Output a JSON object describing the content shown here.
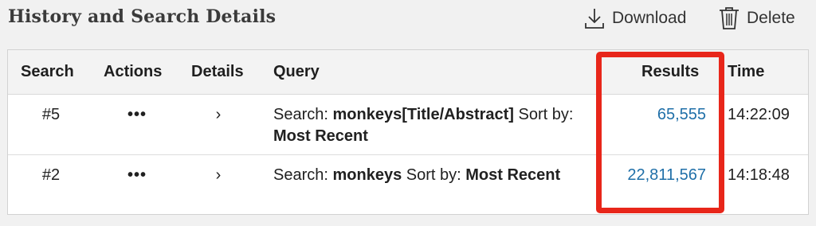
{
  "header": {
    "title": "History and Search Details",
    "download_label": "Download",
    "delete_label": "Delete"
  },
  "table": {
    "columns": {
      "search": "Search",
      "actions": "Actions",
      "details": "Details",
      "query": "Query",
      "results": "Results",
      "time": "Time"
    },
    "rows": [
      {
        "search": "#5",
        "actions": "•••",
        "details": "›",
        "query_prefix": "Search: ",
        "query_term": "monkeys[Title/Abstract]",
        "query_sort_label": " Sort by: ",
        "query_sort_value": "Most Recent",
        "results": "65,555",
        "time": "14:22:09"
      },
      {
        "search": "#2",
        "actions": "•••",
        "details": "›",
        "query_prefix": "Search: ",
        "query_term": "monkeys",
        "query_sort_label": " Sort by: ",
        "query_sort_value": "Most Recent",
        "results": "22,811,567",
        "time": "14:18:48"
      }
    ]
  },
  "colors": {
    "results_link": "#1f6fa8",
    "highlight_border": "#e8261a",
    "background": "#f1f1f1"
  },
  "icons": {
    "download": "download-icon",
    "delete": "trash-icon"
  }
}
